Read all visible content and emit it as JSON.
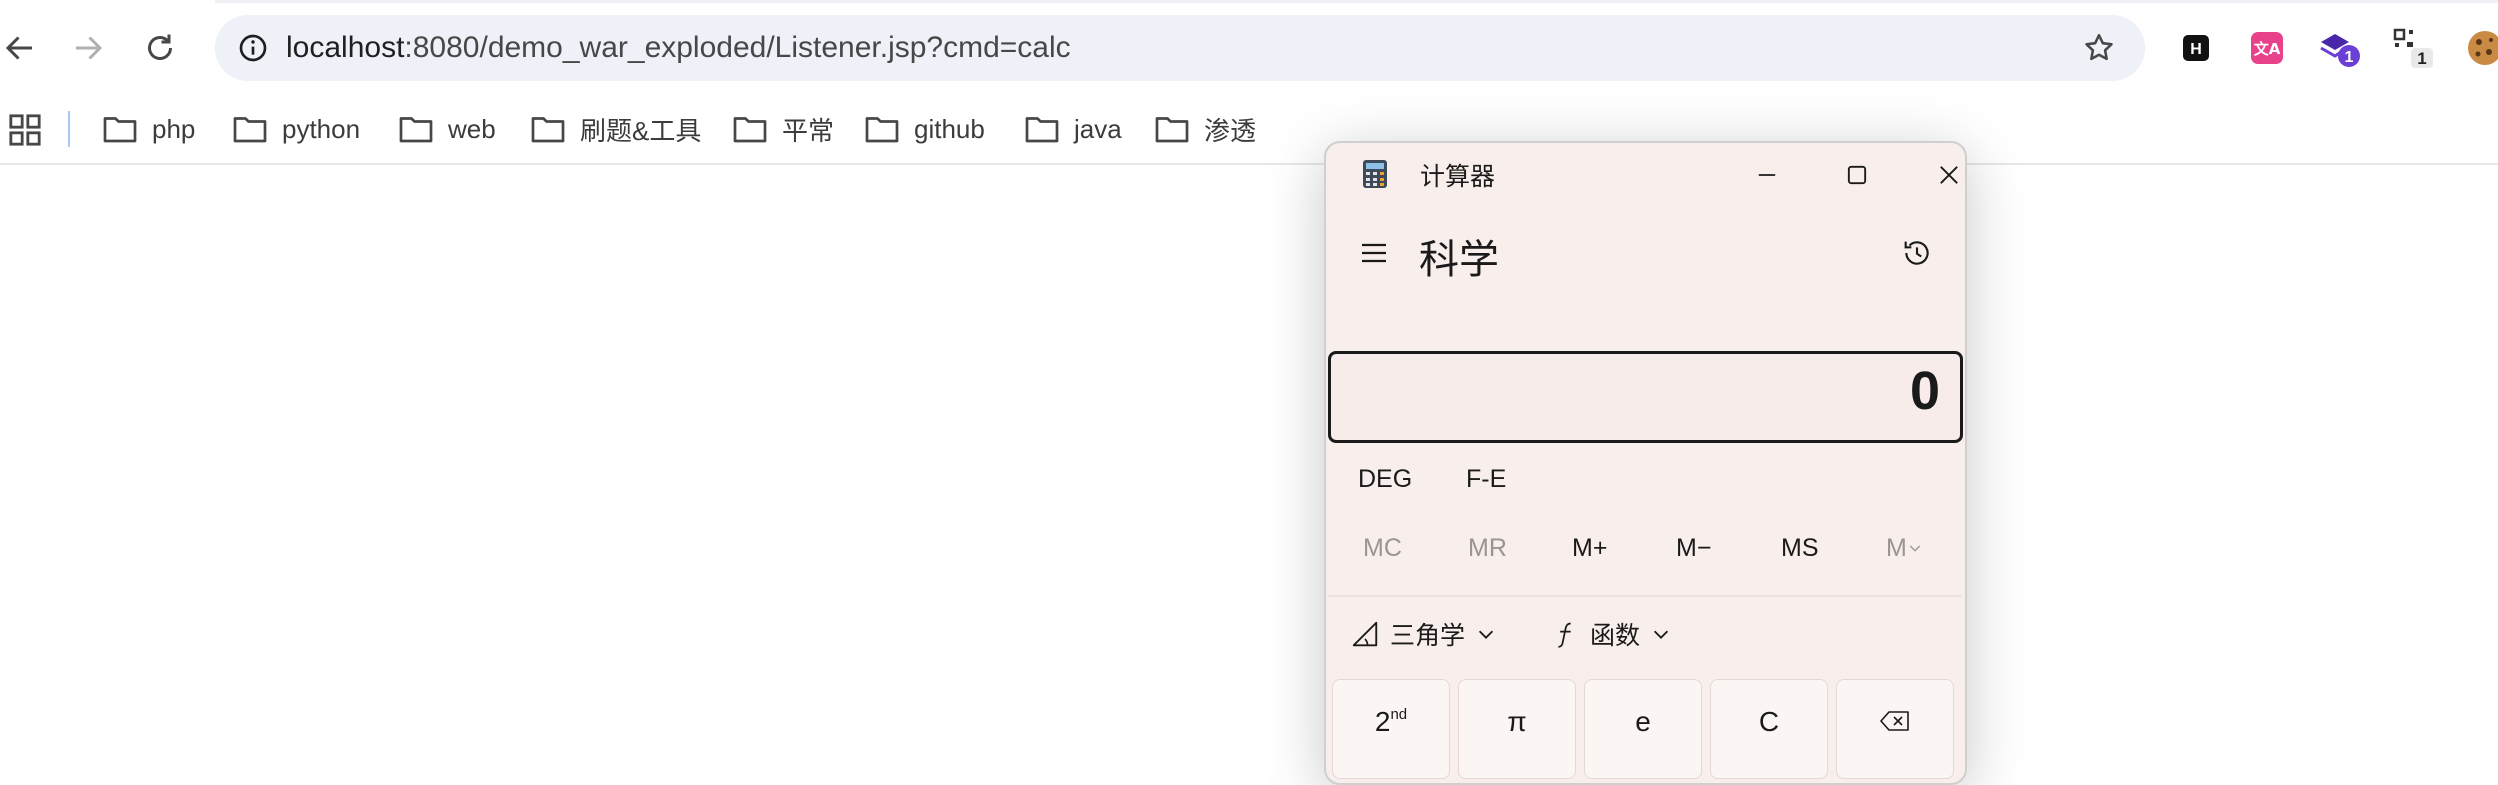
{
  "browser": {
    "url_host": "localhost",
    "url_rest": ":8080/demo_war_exploded/Listener.jsp?cmd=calc",
    "extensions": [
      {
        "name": "h-extension-icon",
        "label": "H"
      },
      {
        "name": "translate-extension-icon",
        "label": "文A"
      },
      {
        "name": "stack-extension-icon",
        "badge": "1"
      },
      {
        "name": "qr-extension-icon",
        "badge": "1"
      },
      {
        "name": "cookie-extension-icon"
      }
    ]
  },
  "bookmarks": [
    {
      "label": "php"
    },
    {
      "label": "python"
    },
    {
      "label": "web"
    },
    {
      "label": "刷题&工具"
    },
    {
      "label": "平常"
    },
    {
      "label": "github"
    },
    {
      "label": "java"
    },
    {
      "label": "渗透"
    }
  ],
  "calculator": {
    "title": "计算器",
    "mode": "科学",
    "display": "0",
    "angle_mode": "DEG",
    "fe_label": "F-E",
    "memory": [
      "MC",
      "MR",
      "M+",
      "M−",
      "MS",
      "M"
    ],
    "trig_label": "三角学",
    "func_label": "函数",
    "keys": {
      "second": "2",
      "second_sup": "nd",
      "pi": "π",
      "e": "e",
      "clear": "C"
    }
  },
  "colors": {
    "omnibox_bg": "#eef1f8",
    "calc_bg": "#f8eeeb",
    "badge_purple": "#6b3fd6",
    "translate_pink": "#e8428a"
  }
}
